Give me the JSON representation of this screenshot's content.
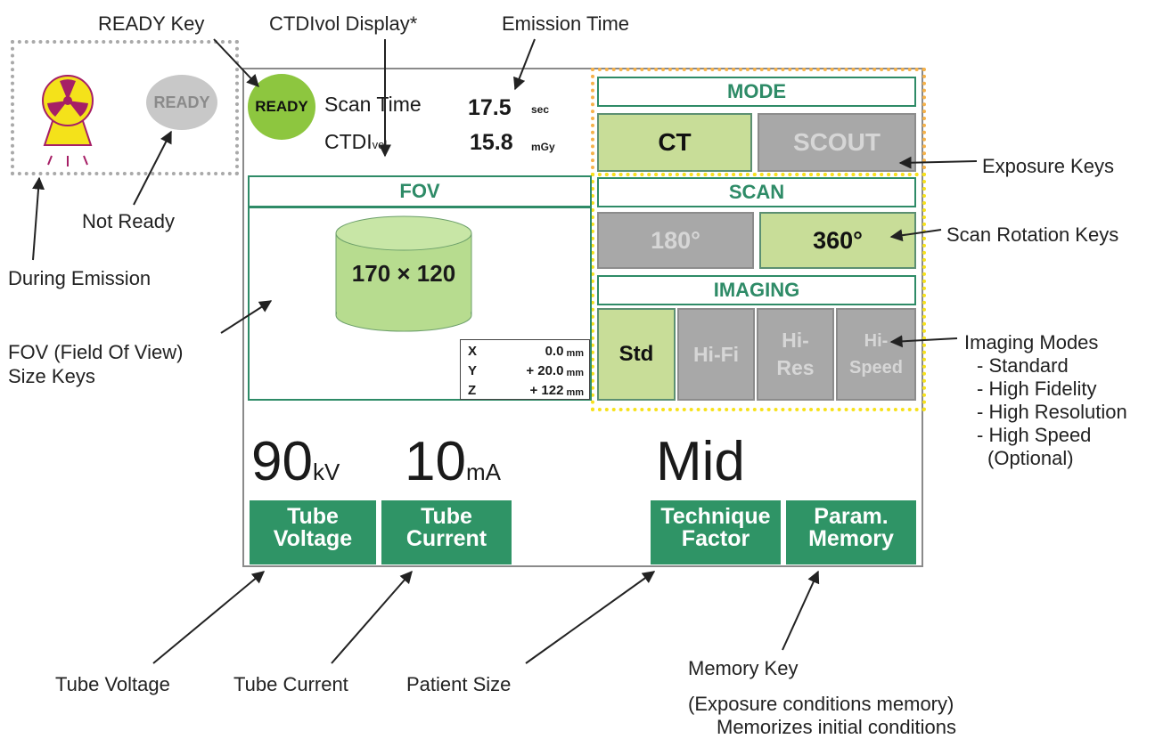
{
  "callouts": {
    "ready_key": "READY Key",
    "ctdi_display": "CTDIvol Display*",
    "emission_time": "Emission Time",
    "during_emission": "During Emission",
    "not_ready": "Not Ready",
    "fov_line1": "FOV (Field Of View)",
    "fov_line2": "Size Keys",
    "exposure_keys": "Exposure Keys",
    "scan_rotation_keys": "Scan Rotation Keys",
    "imaging_modes_title": "Imaging Modes",
    "imaging_modes_list": [
      "- Standard",
      "- High Fidelity",
      "- High Resolution",
      "- High Speed",
      "(Optional)"
    ],
    "tube_voltage": "Tube Voltage",
    "tube_current": "Tube Current",
    "patient_size": "Patient Size",
    "memory_key_line1": "Memory Key",
    "memory_key_line2": "(Exposure conditions memory)",
    "memory_key_line3": "Memorizes initial conditions"
  },
  "ready_states": {
    "not_ready_label": "READY",
    "ready_label": "READY",
    "ready_color": "#8dc63f",
    "not_ready_color": "#c8c8c8"
  },
  "status": {
    "scan_time_label": "Scan Time",
    "scan_time_value": "17.5",
    "scan_time_unit": "sec",
    "ctdi_label_main": "CTDI",
    "ctdi_label_sub": "vol",
    "ctdi_value": "15.8",
    "ctdi_unit": "mGy"
  },
  "mode": {
    "header": "MODE",
    "keys": [
      {
        "label": "CT",
        "active": true
      },
      {
        "label": "SCOUT",
        "active": false
      }
    ]
  },
  "scan": {
    "header": "SCAN",
    "keys": [
      {
        "label": "180°",
        "active": false
      },
      {
        "label": "360°",
        "active": true
      }
    ]
  },
  "imaging": {
    "header": "IMAGING",
    "keys": [
      {
        "label": "Std",
        "active": true
      },
      {
        "label": "Hi-Fi",
        "active": false
      },
      {
        "label_1": "Hi-",
        "label_2": "Res",
        "active": false
      },
      {
        "label_1": "Hi-",
        "label_2": "Speed",
        "active": false
      }
    ]
  },
  "fov": {
    "header": "FOV",
    "size_label": "170 × 120",
    "coords": [
      {
        "axis": "X",
        "value": "0.0",
        "unit": "mm"
      },
      {
        "axis": "Y",
        "value": "+ 20.0",
        "unit": "mm"
      },
      {
        "axis": "Z",
        "value": "+ 122",
        "unit": "mm"
      }
    ]
  },
  "params": {
    "kv_value": "90",
    "kv_unit": "kV",
    "ma_value": "10",
    "ma_unit": "mA",
    "technique_value": "Mid"
  },
  "bottom_keys": {
    "tube_voltage_1": "Tube",
    "tube_voltage_2": "Voltage",
    "tube_current_1": "Tube",
    "tube_current_2": "Current",
    "technique_1": "Technique",
    "technique_2": "Factor",
    "memory_1": "Param.",
    "memory_2": "Memory"
  },
  "colors": {
    "accent_green": "#2f9466",
    "active_key": "#c8dd98",
    "inactive_key": "#a8a8a8",
    "fov_cylinder": "#b7dc8f",
    "radiation_yellow": "#f4e21a",
    "radiation_magenta": "#a61f66"
  }
}
